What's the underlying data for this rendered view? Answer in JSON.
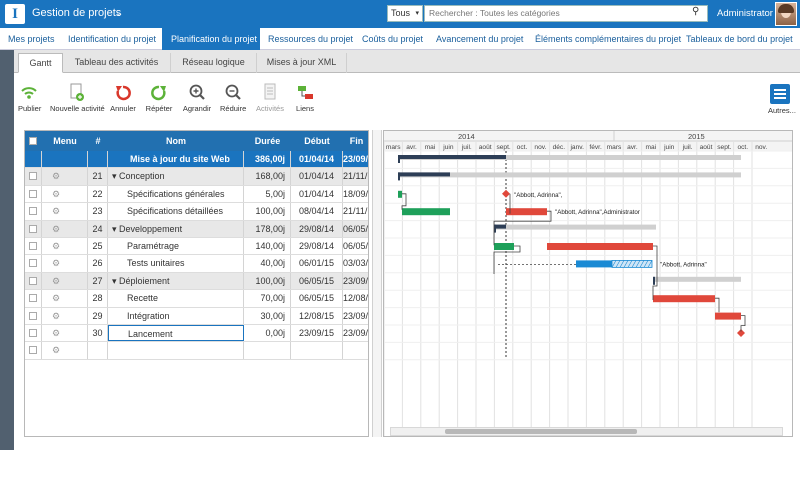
{
  "app": {
    "logo": "I",
    "name": "Gestion de projets",
    "user": "Administrator"
  },
  "search": {
    "scope": "Tous",
    "placeholder": "Rechercher : Toutes les catégories"
  },
  "nav": [
    "Mes projets",
    "Identification du projet",
    "Planification du projet",
    "Ressources du projet",
    "Coûts du projet",
    "Avancement du projet",
    "Éléments complémentaires du projet",
    "Tableaux de bord du projet"
  ],
  "subtabs": [
    "Gantt",
    "Tableau des activités",
    "Réseau logique",
    "Mises à jour XML"
  ],
  "toolbar": {
    "publish": "Publier",
    "new_activity": "Nouvelle activité",
    "undo": "Annuler",
    "redo": "Répéter",
    "zoom_in": "Agrandir",
    "zoom_out": "Réduire",
    "activities": "Activités",
    "links": "Liens",
    "more": "Autres..."
  },
  "colors": {
    "brand": "#1a74bf",
    "bar_green": "#1ea05a",
    "bar_red": "#e0483b",
    "bar_blue": "#1a8ad4",
    "summary_navy": "#2d3e56",
    "summary_gray": "#d0d0d0"
  },
  "grid": {
    "headers": {
      "menu": "Menu",
      "num": "#",
      "name": "Nom",
      "duration": "Durée",
      "start": "Début",
      "end": "Fin"
    },
    "rows": [
      {
        "num": "",
        "name": "Mise à jour du site Web",
        "duration": "386,00j",
        "start": "01/04/14",
        "end": "23/09/15"
      },
      {
        "num": "21",
        "name": "Conception",
        "duration": "168,00j",
        "start": "01/04/14",
        "end": "21/11/14"
      },
      {
        "num": "22",
        "name": "Spécifications générales",
        "duration": "5,00j",
        "start": "01/04/14",
        "end": "18/09/14"
      },
      {
        "num": "23",
        "name": "Spécifications détaillées",
        "duration": "100,00j",
        "start": "08/04/14",
        "end": "21/11/14"
      },
      {
        "num": "24",
        "name": "Developpement",
        "duration": "178,00j",
        "start": "29/08/14",
        "end": "06/05/15"
      },
      {
        "num": "25",
        "name": "Paramétrage",
        "duration": "140,00j",
        "start": "29/08/14",
        "end": "06/05/15"
      },
      {
        "num": "26",
        "name": "Tests unitaires",
        "duration": "40,00j",
        "start": "06/01/15",
        "end": "03/03/15"
      },
      {
        "num": "27",
        "name": "Déploiement",
        "duration": "100,00j",
        "start": "06/05/15",
        "end": "23/09/15"
      },
      {
        "num": "28",
        "name": "Recette",
        "duration": "70,00j",
        "start": "06/05/15",
        "end": "12/08/15"
      },
      {
        "num": "29",
        "name": "Intégration",
        "duration": "30,00j",
        "start": "12/08/15",
        "end": "23/09/15"
      },
      {
        "num": "30",
        "name": "Lancement",
        "duration": "0,00j",
        "start": "23/09/15",
        "end": "23/09/15"
      },
      {
        "num": "",
        "name": "",
        "duration": "",
        "start": "",
        "end": ""
      }
    ]
  },
  "gantt": {
    "years": [
      "2014",
      "2015"
    ],
    "months": [
      "mars",
      "avr.",
      "mai",
      "juin",
      "juil.",
      "août",
      "sept.",
      "oct.",
      "nov.",
      "déc.",
      "janv.",
      "févr.",
      "mars",
      "avr.",
      "mai",
      "juin",
      "juil.",
      "août",
      "sept.",
      "oct.",
      "nov."
    ],
    "labels": [
      "\"Abbott, Adrinna\",",
      "\"Abbott, Adrinna\",Administrator",
      "\"Abbott, Adrinna\""
    ]
  }
}
